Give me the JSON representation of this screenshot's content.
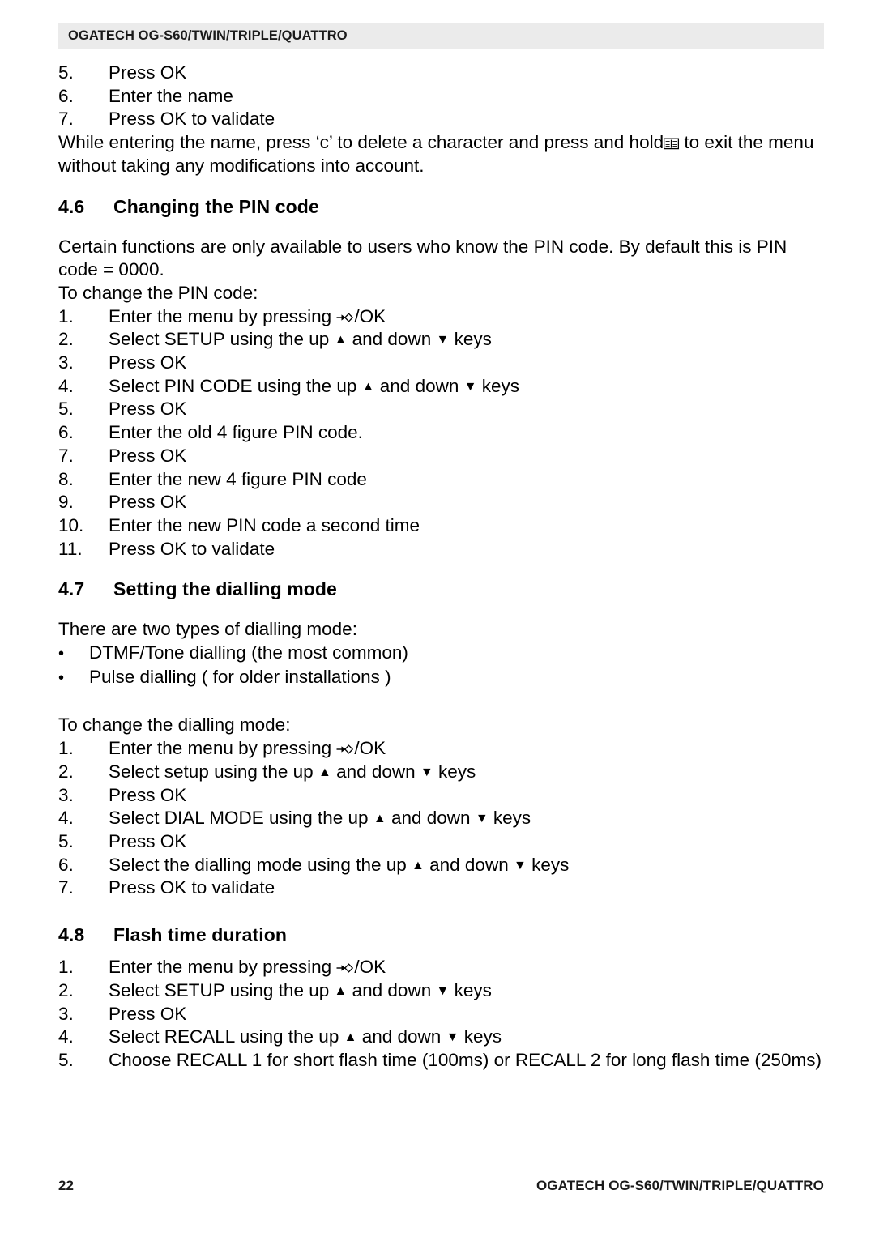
{
  "header": {
    "running_title": "OGATECH OG-S60/TWIN/TRIPLE/QUATTRO"
  },
  "intro_list": {
    "items": [
      {
        "num": "5.",
        "text": "Press OK"
      },
      {
        "num": "6.",
        "text": "Enter the name"
      },
      {
        "num": "7.",
        "text": "Press OK to validate"
      }
    ]
  },
  "intro_paragraph": {
    "part1": "While entering the name, press ‘c’ to delete a character and press and hold",
    "part2": "to exit the menu without taking any modifications into account."
  },
  "section_46": {
    "number": "4.6",
    "title": "Changing the PIN code",
    "paragraph_1": "Certain functions are only available to users who know the PIN code. By default this is PIN code = 0000.",
    "paragraph_2": "To change the PIN code:",
    "steps": [
      {
        "num": "1.",
        "pre": "Enter the menu by pressing",
        "glyph": "menu",
        "post": "/OK"
      },
      {
        "num": "2.",
        "pre": "Select SETUP using the up",
        "glyph": "updown",
        "mid": "and down",
        "post": "keys"
      },
      {
        "num": "3.",
        "pre": "Press OK"
      },
      {
        "num": "4.",
        "pre": "Select PIN CODE using the up",
        "glyph": "updown",
        "mid": "and down",
        "post": "keys"
      },
      {
        "num": "5.",
        "pre": "Press OK"
      },
      {
        "num": "6.",
        "pre": "Enter the old 4 figure PIN code."
      },
      {
        "num": "7.",
        "pre": "Press OK"
      },
      {
        "num": "8.",
        "pre": "Enter the new 4 figure PIN code"
      },
      {
        "num": "9.",
        "pre": "Press OK"
      },
      {
        "num": "10.",
        "pre": "Enter the new PIN code a second time"
      },
      {
        "num": "11.",
        "pre": "Press OK to validate"
      }
    ]
  },
  "section_47": {
    "number": "4.7",
    "title": "Setting the dialling mode",
    "paragraph_1": "There are two types of dialling mode:",
    "bullets": [
      {
        "bullet": "•",
        "text": "DTMF/Tone dialling (the most common)"
      },
      {
        "bullet": "•",
        "text": "Pulse dialling ( for older installations )"
      }
    ],
    "paragraph_2": "To change the dialling mode:",
    "steps": [
      {
        "num": "1.",
        "pre": "Enter the menu by pressing",
        "glyph": "menu",
        "post": "/OK"
      },
      {
        "num": "2.",
        "pre": "Select setup using the up",
        "glyph": "updown",
        "mid": "and down",
        "post": "keys"
      },
      {
        "num": "3.",
        "pre": "Press OK"
      },
      {
        "num": "4.",
        "pre": "Select DIAL MODE using the up",
        "glyph": "updown",
        "mid": "and down",
        "post": "keys"
      },
      {
        "num": "5.",
        "pre": "Press OK"
      },
      {
        "num": "6.",
        "pre": "Select the dialling mode using the up",
        "glyph": "updown",
        "mid": "and down",
        "post": "keys"
      },
      {
        "num": "7.",
        "pre": "Press OK to validate"
      }
    ]
  },
  "section_48": {
    "number": "4.8",
    "title": "Flash time duration",
    "steps": [
      {
        "num": "1.",
        "pre": "Enter the menu by pressing",
        "glyph": "menu",
        "post": "/OK"
      },
      {
        "num": "2.",
        "pre": "Select SETUP using the up",
        "glyph": "updown",
        "mid": "and down",
        "post": "keys"
      },
      {
        "num": "3.",
        "pre": "Press OK"
      },
      {
        "num": "4.",
        "pre": "Select RECALL using the up",
        "glyph": "updown",
        "mid": "and down",
        "post": "keys"
      },
      {
        "num": "5.",
        "pre": "Choose RECALL 1 for short flash time (100ms) or RECALL 2 for long flash time (250ms)"
      }
    ]
  },
  "footer": {
    "page_number": "22",
    "document_title": "OGATECH OG-S60/TWIN/TRIPLE/QUATTRO"
  },
  "glyphs": {
    "up_triangle": "▲",
    "down_triangle": "▼",
    "book": "book-icon",
    "menu_enter": "menu-enter-icon"
  },
  "colors": {
    "header_band_bg": "#ebebeb",
    "text": "#000000",
    "page_bg": "#ffffff"
  }
}
